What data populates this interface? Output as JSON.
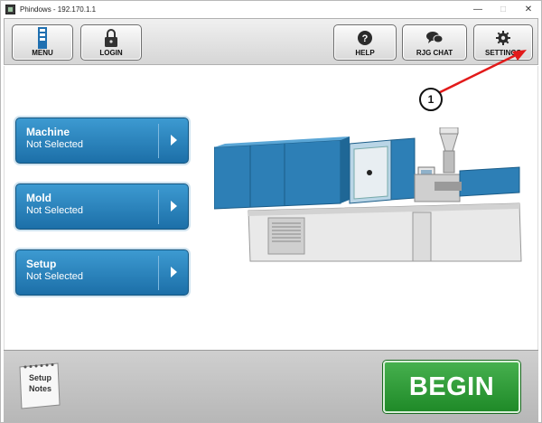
{
  "window": {
    "title": "Phindows - 192.170.1.1",
    "minimize": "—",
    "maximize": "□",
    "close": "✕"
  },
  "toolbar": {
    "menu_label": "MENU",
    "login_label": "LOGIN",
    "help_label": "HELP",
    "chat_label": "RJG CHAT",
    "settings_label": "SETTINGS"
  },
  "selectors": [
    {
      "title": "Machine",
      "status": "Not Selected"
    },
    {
      "title": "Mold",
      "status": "Not Selected"
    },
    {
      "title": "Setup",
      "status": "Not Selected"
    }
  ],
  "footer": {
    "notes_line1": "Setup",
    "notes_line2": "Notes",
    "begin_label": "BEGIN"
  },
  "callout": {
    "number": "1"
  },
  "colors": {
    "accent_blue": "#2580bd",
    "begin_green": "#2f9e37",
    "callout_red": "#e21a1a"
  }
}
